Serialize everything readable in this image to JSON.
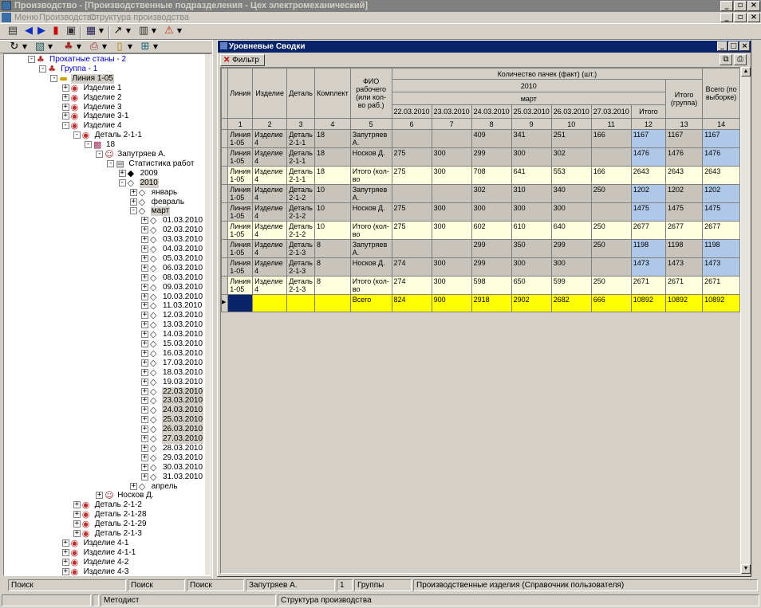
{
  "window": {
    "title": "Производство - [Производственные подразделения - Цех электромеханический]"
  },
  "menu": [
    "Меню",
    "Производство",
    "Структура производства"
  ],
  "child": {
    "title": "Уровневые Сводки",
    "filter_label": "Фильтр"
  },
  "tree": [
    {
      "t": "Прокатные станы - 2",
      "l": 0,
      "pm": "-",
      "ic": "grp",
      "blue": true
    },
    {
      "t": "Группа - 1",
      "l": 1,
      "pm": "-",
      "ic": "grp",
      "blue": true
    },
    {
      "t": "Линия 1-05",
      "l": 2,
      "pm": "-",
      "ic": "folder",
      "sel": true
    },
    {
      "t": "Изделие 1",
      "l": 3,
      "pm": "+",
      "ic": "item"
    },
    {
      "t": "Изделие 2",
      "l": 3,
      "pm": "+",
      "ic": "item"
    },
    {
      "t": "Изделие 3",
      "l": 3,
      "pm": "+",
      "ic": "item"
    },
    {
      "t": "Изделие 3-1",
      "l": 3,
      "pm": "+",
      "ic": "item"
    },
    {
      "t": "Изделие 4",
      "l": 3,
      "pm": "-",
      "ic": "item"
    },
    {
      "t": "Деталь 2-1-1",
      "l": 4,
      "pm": "-",
      "ic": "item"
    },
    {
      "t": "18",
      "l": 5,
      "pm": "-",
      "ic": "kit"
    },
    {
      "t": "Запутряев А.",
      "l": 6,
      "pm": "-",
      "ic": "person"
    },
    {
      "t": "Статистика работ",
      "l": 7,
      "pm": "-",
      "ic": "doc"
    },
    {
      "t": "2009",
      "l": 8,
      "pm": "+",
      "ic": "dia_f"
    },
    {
      "t": "2010",
      "l": 8,
      "pm": "-",
      "ic": "dia",
      "sel": true
    },
    {
      "t": "январь",
      "l": 9,
      "pm": "+",
      "ic": "dia"
    },
    {
      "t": "февраль",
      "l": 9,
      "pm": "+",
      "ic": "dia"
    },
    {
      "t": "март",
      "l": 9,
      "pm": "-",
      "ic": "dia",
      "sel": true
    },
    {
      "t": "01.03.2010",
      "l": 10,
      "pm": "+",
      "ic": "dia"
    },
    {
      "t": "02.03.2010",
      "l": 10,
      "pm": "+",
      "ic": "dia"
    },
    {
      "t": "03.03.2010",
      "l": 10,
      "pm": "+",
      "ic": "dia"
    },
    {
      "t": "04.03.2010",
      "l": 10,
      "pm": "+",
      "ic": "dia"
    },
    {
      "t": "05.03.2010",
      "l": 10,
      "pm": "+",
      "ic": "dia"
    },
    {
      "t": "06.03.2010",
      "l": 10,
      "pm": "+",
      "ic": "dia"
    },
    {
      "t": "08.03.2010",
      "l": 10,
      "pm": "+",
      "ic": "dia"
    },
    {
      "t": "09.03.2010",
      "l": 10,
      "pm": "+",
      "ic": "dia"
    },
    {
      "t": "10.03.2010",
      "l": 10,
      "pm": "+",
      "ic": "dia"
    },
    {
      "t": "11.03.2010",
      "l": 10,
      "pm": "+",
      "ic": "dia"
    },
    {
      "t": "12.03.2010",
      "l": 10,
      "pm": "+",
      "ic": "dia"
    },
    {
      "t": "13.03.2010",
      "l": 10,
      "pm": "+",
      "ic": "dia"
    },
    {
      "t": "14.03.2010",
      "l": 10,
      "pm": "+",
      "ic": "dia"
    },
    {
      "t": "15.03.2010",
      "l": 10,
      "pm": "+",
      "ic": "dia"
    },
    {
      "t": "16.03.2010",
      "l": 10,
      "pm": "+",
      "ic": "dia"
    },
    {
      "t": "17.03.2010",
      "l": 10,
      "pm": "+",
      "ic": "dia"
    },
    {
      "t": "18.03.2010",
      "l": 10,
      "pm": "+",
      "ic": "dia"
    },
    {
      "t": "19.03.2010",
      "l": 10,
      "pm": "+",
      "ic": "dia"
    },
    {
      "t": "22.03.2010",
      "l": 10,
      "pm": "+",
      "ic": "dia",
      "sel": true
    },
    {
      "t": "23.03.2010",
      "l": 10,
      "pm": "+",
      "ic": "dia",
      "sel": true
    },
    {
      "t": "24.03.2010",
      "l": 10,
      "pm": "+",
      "ic": "dia",
      "sel": true
    },
    {
      "t": "25.03.2010",
      "l": 10,
      "pm": "+",
      "ic": "dia",
      "sel": true
    },
    {
      "t": "26.03.2010",
      "l": 10,
      "pm": "+",
      "ic": "dia",
      "sel": true
    },
    {
      "t": "27.03.2010",
      "l": 10,
      "pm": "+",
      "ic": "dia",
      "sel": true
    },
    {
      "t": "28.03.2010",
      "l": 10,
      "pm": "+",
      "ic": "dia"
    },
    {
      "t": "29.03.2010",
      "l": 10,
      "pm": "+",
      "ic": "dia"
    },
    {
      "t": "30.03.2010",
      "l": 10,
      "pm": "+",
      "ic": "dia"
    },
    {
      "t": "31.03.2010",
      "l": 10,
      "pm": "+",
      "ic": "dia"
    },
    {
      "t": "апрель",
      "l": 9,
      "pm": "+",
      "ic": "dia"
    },
    {
      "t": "Носков Д.",
      "l": 6,
      "pm": "+",
      "ic": "person"
    },
    {
      "t": "Деталь 2-1-2",
      "l": 4,
      "pm": "+",
      "ic": "item"
    },
    {
      "t": "Деталь 2-1-28",
      "l": 4,
      "pm": "+",
      "ic": "item"
    },
    {
      "t": "Деталь 2-1-29",
      "l": 4,
      "pm": "+",
      "ic": "item"
    },
    {
      "t": "Деталь 2-1-3",
      "l": 4,
      "pm": "+",
      "ic": "item"
    },
    {
      "t": "Изделие 4-1",
      "l": 3,
      "pm": "+",
      "ic": "item"
    },
    {
      "t": "Изделие 4-1-1",
      "l": 3,
      "pm": "+",
      "ic": "item"
    },
    {
      "t": "Изделие 4-2",
      "l": 3,
      "pm": "+",
      "ic": "item"
    },
    {
      "t": "Изделие 4-3",
      "l": 3,
      "pm": "+",
      "ic": "item"
    }
  ],
  "grid": {
    "h_line": "Линия",
    "h_item": "Изделие",
    "h_part": "Деталь",
    "h_kit": "Комплект",
    "h_fio": "ФИО рабочего (или кол-во раб.)",
    "h_qty": "Количество пачек (факт) (шт.)",
    "h_year": "2010",
    "h_month": "март",
    "h_total": "Итого",
    "h_total_grp": "Итого (группа)",
    "h_total_all": "Всего (по выборке)",
    "dates": [
      "22.03.2010",
      "23.03.2010",
      "24.03.2010",
      "25.03.2010",
      "26.03.2010",
      "27.03.2010"
    ],
    "colnums": [
      "1",
      "2",
      "3",
      "4",
      "5",
      "6",
      "7",
      "8",
      "9",
      "10",
      "11",
      "12",
      "13",
      "14"
    ],
    "rows": [
      {
        "k": "g",
        "c": [
          "Линия 1-05",
          "Изделие 4",
          "Деталь 2-1-1",
          "18",
          "Запутряев А.",
          "",
          "",
          "409",
          "341",
          "251",
          "166",
          "1167",
          "1167",
          "1167"
        ]
      },
      {
        "k": "g",
        "c": [
          "Линия 1-05",
          "Изделие 4",
          "Деталь 2-1-1",
          "18",
          "Носков Д.",
          "275",
          "300",
          "299",
          "300",
          "302",
          "",
          "1476",
          "1476",
          "1476"
        ]
      },
      {
        "k": "cy",
        "c": [
          "Линия 1-05",
          "Изделие 4",
          "Деталь 2-1-1",
          "18",
          "Итого (кол-во",
          "275",
          "300",
          "708",
          "641",
          "553",
          "166",
          "2643",
          "2643",
          "2643"
        ]
      },
      {
        "k": "g",
        "c": [
          "Линия 1-05",
          "Изделие 4",
          "Деталь 2-1-2",
          "10",
          "Запутряев А.",
          "",
          "",
          "302",
          "310",
          "340",
          "250",
          "1202",
          "1202",
          "1202"
        ]
      },
      {
        "k": "g",
        "c": [
          "Линия 1-05",
          "Изделие 4",
          "Деталь 2-1-2",
          "10",
          "Носков Д.",
          "275",
          "300",
          "300",
          "300",
          "300",
          "",
          "1475",
          "1475",
          "1475"
        ]
      },
      {
        "k": "cy",
        "c": [
          "Линия 1-05",
          "Изделие 4",
          "Деталь 2-1-2",
          "10",
          "Итого (кол-во",
          "275",
          "300",
          "602",
          "610",
          "640",
          "250",
          "2677",
          "2677",
          "2677"
        ]
      },
      {
        "k": "g",
        "c": [
          "Линия 1-05",
          "Изделие 4",
          "Деталь 2-1-3",
          "8",
          "Запутряев А.",
          "",
          "",
          "299",
          "350",
          "299",
          "250",
          "1198",
          "1198",
          "1198"
        ]
      },
      {
        "k": "g",
        "c": [
          "Линия 1-05",
          "Изделие 4",
          "Деталь 2-1-3",
          "8",
          "Носков Д.",
          "274",
          "300",
          "299",
          "300",
          "300",
          "",
          "1473",
          "1473",
          "1473"
        ]
      },
      {
        "k": "cy",
        "c": [
          "Линия 1-05",
          "Изделие 4",
          "Деталь 2-1-3",
          "8",
          "Итого (кол-во",
          "274",
          "300",
          "598",
          "650",
          "599",
          "250",
          "2671",
          "2671",
          "2671"
        ]
      },
      {
        "k": "yl",
        "c": [
          "",
          "",
          "",
          "",
          "Всего",
          "824",
          "900",
          "2918",
          "2902",
          "2682",
          "666",
          "10892",
          "10892",
          "10892"
        ]
      }
    ]
  },
  "status": {
    "s1": "Поиск",
    "s2": "Поиск",
    "s3": "Поиск",
    "s4": "Запутряев А.",
    "s5": "1",
    "s6": "Группы",
    "s7": "Производственные изделия (Справочник пользователя)",
    "s8": "Методист",
    "s9": "Структура производства"
  }
}
